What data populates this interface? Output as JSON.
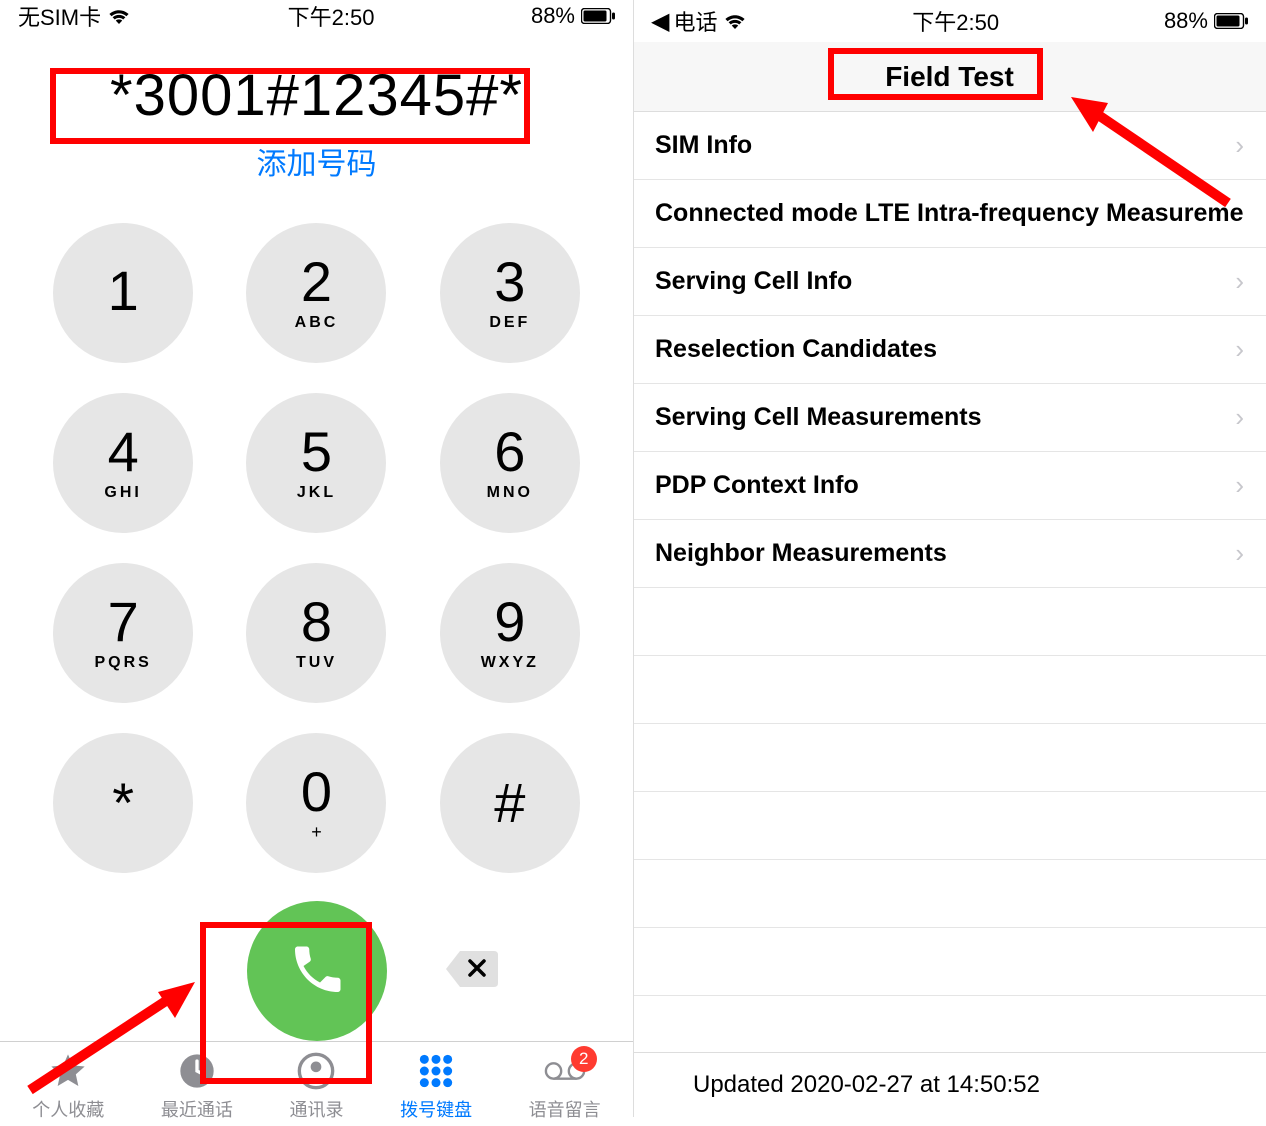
{
  "left": {
    "status": {
      "carrier": "无SIM卡",
      "time": "下午2:50",
      "battery": "88%"
    },
    "dialed": "*3001#12345#*",
    "add_label": "添加号码",
    "keys": [
      {
        "d": "1",
        "l": ""
      },
      {
        "d": "2",
        "l": "ABC"
      },
      {
        "d": "3",
        "l": "DEF"
      },
      {
        "d": "4",
        "l": "GHI"
      },
      {
        "d": "5",
        "l": "JKL"
      },
      {
        "d": "6",
        "l": "MNO"
      },
      {
        "d": "7",
        "l": "PQRS"
      },
      {
        "d": "8",
        "l": "TUV"
      },
      {
        "d": "9",
        "l": "WXYZ"
      },
      {
        "d": "*",
        "l": ""
      },
      {
        "d": "0",
        "l": "+"
      },
      {
        "d": "#",
        "l": ""
      }
    ],
    "tabs": [
      {
        "label": "个人收藏"
      },
      {
        "label": "最近通话"
      },
      {
        "label": "通讯录"
      },
      {
        "label": "拨号键盘"
      },
      {
        "label": "语音留言"
      }
    ],
    "voicemail_badge": "2"
  },
  "right": {
    "status": {
      "carrier": "电话",
      "time": "下午2:50",
      "battery": "88%"
    },
    "title": "Field Test",
    "rows": [
      "SIM Info",
      "Connected mode LTE Intra-frequency Measuremen",
      "Serving Cell Info",
      "Reselection Candidates",
      "Serving Cell Measurements",
      "PDP Context Info",
      "Neighbor Measurements"
    ],
    "footer": "Updated 2020-02-27 at 14:50:52"
  }
}
